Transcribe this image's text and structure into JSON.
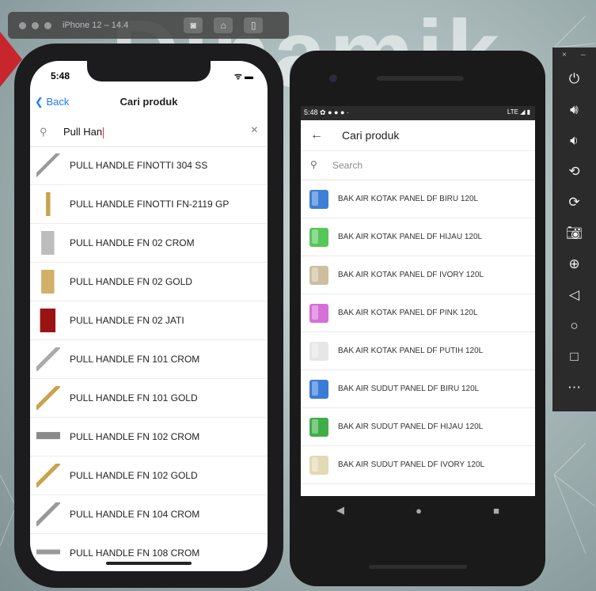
{
  "simulator": {
    "title": "iPhone 12 – 14.4"
  },
  "ios": {
    "status_time": "5:48",
    "status_icons": "ᯤ ▬",
    "back_label": "Back",
    "title": "Cari produk",
    "search_value": "Pull Han",
    "products": [
      "PULL HANDLE FINOTTI 304 SS",
      "PULL HANDLE FINOTTI FN-2119 GP",
      "PULL HANDLE FN 02 CROM",
      "PULL HANDLE FN 02 GOLD",
      "PULL HANDLE FN 02 JATI",
      "PULL HANDLE FN 101 CROM",
      "PULL HANDLE FN 101 GOLD",
      "PULL HANDLE FN 102 CROM",
      "PULL HANDLE FN 102 GOLD",
      "PULL HANDLE FN 104 CROM",
      "PULL HANDLE FN 108 CROM"
    ]
  },
  "android": {
    "status_time": "5:48",
    "status_icons_left": "✿ ● ● ● ·",
    "status_icons_right": "LTE ◢ ▮",
    "title": "Cari produk",
    "search_placeholder": "Search",
    "products": [
      {
        "label": "BAK AIR KOTAK PANEL DF BIRU 120L",
        "color": "#3d7fd6"
      },
      {
        "label": "BAK AIR KOTAK PANEL DF HIJAU 120L",
        "color": "#55c65a"
      },
      {
        "label": "BAK AIR KOTAK PANEL DF IVORY 120L",
        "color": "#cdbf9e"
      },
      {
        "label": "BAK AIR KOTAK PANEL DF PINK 120L",
        "color": "#d76fd6"
      },
      {
        "label": "BAK AIR KOTAK PANEL DF PUTIH 120L",
        "color": "#e6e6e6"
      },
      {
        "label": "BAK AIR SUDUT PANEL DF BIRU 120L",
        "color": "#3a7bd8"
      },
      {
        "label": "BAK AIR SUDUT PANEL DF HIJAU 120L",
        "color": "#3fae48"
      },
      {
        "label": "BAK AIR SUDUT PANEL DF IVORY 120L",
        "color": "#e2d9b5"
      }
    ]
  }
}
